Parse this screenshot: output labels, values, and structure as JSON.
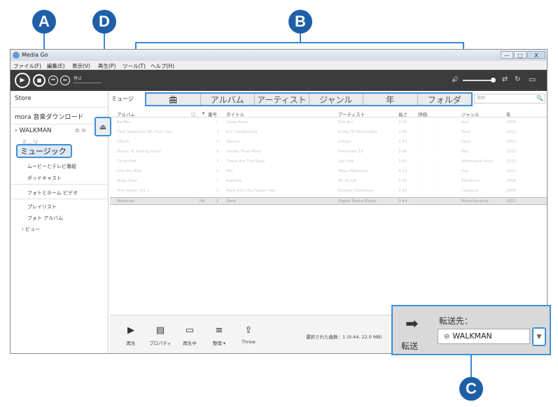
{
  "callouts": {
    "a": "A",
    "b": "B",
    "c": "C",
    "d": "D"
  },
  "window": {
    "title": "Media Go",
    "controls": {
      "minimize": "—",
      "maximize": "□",
      "close": "X"
    }
  },
  "menu": [
    "ファイル(F)",
    "編集(E)",
    "表示(V)",
    "再生(P)",
    "ツール(T)",
    "ヘルプ(H)"
  ],
  "player": {
    "play": "▶",
    "stop": "■",
    "prev": "⏮",
    "next": "⏭",
    "status": "停止",
    "volume_icon": "🔊",
    "shuffle": "⇄",
    "repeat": "↻",
    "view": "▭"
  },
  "sidebar": {
    "store": "Store",
    "mora": "mora 音楽ダウンロード",
    "walkman": "› WALKMAN",
    "memory": "ミュージック",
    "memory_partial": "ミ...リ",
    "music": "ミュージック",
    "items": [
      "ムービーとテレビ番組",
      "ポッドキャスト",
      "フォトとホーム ビデオ",
      "プレイリスト",
      "フォト アルバム",
      "› ビュー"
    ]
  },
  "eject_icon": "⏏",
  "main": {
    "breadcrumb": "ミュージ",
    "tabs": [
      "曲",
      "アルバム",
      "アーティスト",
      "ジャンル",
      "年",
      "フォルダ"
    ],
    "search_placeholder": "検索",
    "search_icon": "🔍",
    "columns": {
      "album": "アルバム",
      "info": "ⓘ",
      "sort": "▾",
      "num": "番号",
      "title": "タイトル",
      "artist": "アーティスト",
      "length": "長さ",
      "rating": "評価",
      "genre": "ジャンル",
      "year": "年"
    },
    "rows": [
      {
        "album": "Be Mini",
        "num": "1",
        "title": "Sleep Away",
        "artist": "Bob Acri",
        "len": "3:20",
        "rating": "· · · · ·",
        "genre": "Jazz",
        "year": "2004"
      },
      {
        "album": "That Separates Me From You",
        "num": "3",
        "title": "It's Complicated",
        "artist": "A Day To Remember",
        "len": "2:46",
        "rating": "· · · · ·",
        "genre": "Rock",
        "year": "2011"
      },
      {
        "album": "Album",
        "num": "7",
        "title": "Silence",
        "artist": "Edison",
        "len": "3:47",
        "rating": "· · · · ·",
        "genre": "Rock",
        "year": "2010"
      },
      {
        "album": "Heroic To Feeling Good",
        "num": "4",
        "title": "Harder Than Mine",
        "artist": "Freshmen 15",
        "len": "3:06",
        "rating": "· · · · ·",
        "genre": "Pop",
        "year": "2011"
      },
      {
        "album": "Think Fast",
        "num": "3",
        "title": "These Are The Days",
        "artist": "Just Left",
        "len": "3:41",
        "rating": "· · · · ·",
        "genre": "Alternative Rock",
        "year": "2011"
      },
      {
        "album": "Into the Wild",
        "num": "2",
        "title": "Fall",
        "artist": "Mayu Wakisaka",
        "len": "4:24",
        "rating": "· · · · ·",
        "genre": "Pop",
        "year": "2011"
      },
      {
        "album": "Ninja Tuna",
        "num": "1",
        "title": "Kalimba",
        "artist": "Mr. Scruff",
        "len": "5:48",
        "rating": "· · · · ·",
        "genre": "Electronic",
        "year": "2008"
      },
      {
        "album": "Fine Music, Vol. 1",
        "num": "2",
        "title": "Maid with the Flaxen Hair",
        "artist": "Richard Stoltzman",
        "len": "2:49",
        "rating": "· · · · ·",
        "genre": "Classical",
        "year": "2008"
      },
      {
        "album": "Walkman",
        "hk": "HK",
        "num": "1",
        "title": "Sona",
        "artist": "Digital Media Player",
        "len": "0:44",
        "rating": "· · · · ·",
        "genre": "Miscellaneous ...",
        "year": "2012"
      }
    ]
  },
  "bottom": {
    "buttons": [
      {
        "icon": "▶",
        "label": "再生"
      },
      {
        "icon": "▤",
        "label": "プロパティ"
      },
      {
        "icon": "▭",
        "label": "再生中"
      },
      {
        "icon": "≡",
        "label": "整理 ▾"
      },
      {
        "icon": "⇪",
        "label": "Throw"
      }
    ],
    "selection_info": "選択された曲数：1 (0:44, 22.0 MB)"
  },
  "transfer": {
    "arrow": "➡",
    "label": "転送",
    "to_label": "転送先：",
    "device_icon": "⊜",
    "device": "WALKMAN",
    "dropdown": "▼"
  }
}
